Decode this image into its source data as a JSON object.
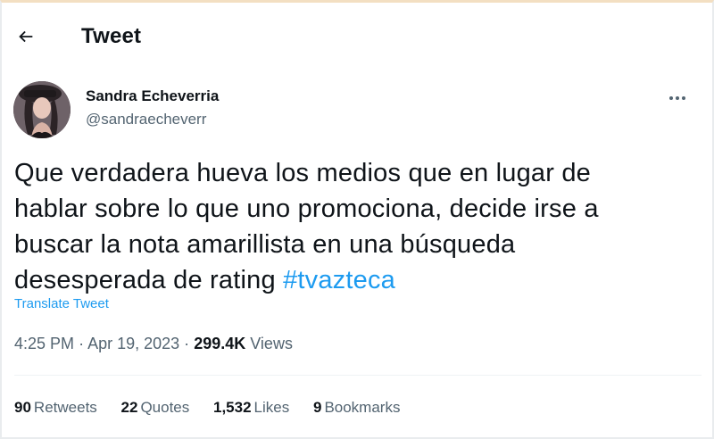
{
  "header": {
    "title": "Tweet",
    "back_icon": "arrow-left-icon"
  },
  "author": {
    "display_name": "Sandra Echeverria",
    "handle": "@sandraecheverr",
    "avatar_icon": "profile-photo",
    "more_icon": "more-horizontal-icon"
  },
  "tweet": {
    "text_lines": [
      "Que verdadera hueva los medios que en lugar de",
      "hablar sobre lo que uno promociona, decide irse a",
      "buscar la nota amarillista en una búsqueda",
      "desesperada de rating "
    ],
    "hashtag": "#tvazteca",
    "translate_label": "Translate Tweet"
  },
  "meta": {
    "time": "4:25 PM",
    "separator": "·",
    "date": "Apr 19, 2023",
    "views_count": "299.4K",
    "views_label": "Views"
  },
  "stats": {
    "retweets_count": "90",
    "retweets_label": "Retweets",
    "quotes_count": "22",
    "quotes_label": "Quotes",
    "likes_count": "1,532",
    "likes_label": "Likes",
    "bookmarks_count": "9",
    "bookmarks_label": "Bookmarks"
  },
  "colors": {
    "link": "#1d9bf0",
    "text": "#0f1419",
    "secondary": "#536471",
    "divider": "#eff3f4"
  }
}
